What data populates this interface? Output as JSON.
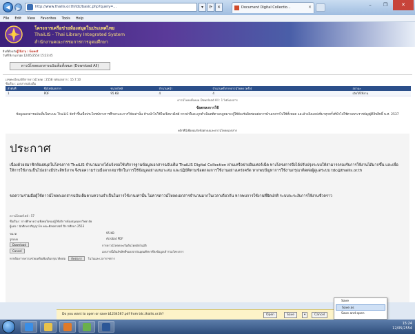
{
  "browser": {
    "address": "http://www.thailis.or.th/tdc/basic.php?query=...",
    "tab_title": "Document Digital Collectio...",
    "tab_close": "×",
    "menu": [
      "File",
      "Edit",
      "View",
      "Favorites",
      "Tools",
      "Help"
    ],
    "addr_tools": [
      "▾",
      "⟳",
      "✕"
    ],
    "window_controls": [
      "–",
      "❐",
      "✕"
    ]
  },
  "banner": {
    "line1": "โครงการเครือข่ายห้องสมุดในประเทศไทย",
    "line2": "ThaiLIS - Thai Library Integrated System",
    "line3": "สำนักงานคณะกรรมการการอุดมศึกษา"
  },
  "user": {
    "line1_prefix": "ยินดีต้อนรับ",
    "line1_name": "ผู้ใช้งาน : Guest",
    "line2": "วันที่ใช้งานล่าสุด 12/05/2554 15:23:45"
  },
  "top_button": "ดาวน์โหลดเอกสารฉบับเต็มทั้งหมด (Download All)",
  "meta": {
    "line1": "เลขทะเบียนสถิติการดาวน์โหลด : 2558 รหัสเอกสาร : 15.7.10",
    "line2": "ชื่อเรื่อง : เอกสารฉบับเต็ม"
  },
  "stats_table": {
    "headers": [
      "ลำดับที่",
      "ชื่อไฟล์เอกสาร",
      "ขนาดไฟล์",
      "จำนวนหน้า",
      "จำนวนครั้งการดาวน์โหลด (ครั้ง)",
      "สถานะ"
    ],
    "row": [
      "1",
      "PDF",
      "95 KB",
      "4",
      "4",
      "เปิดให้ใช้งาน"
    ]
  },
  "bar_note": "ดาวน์โหลดทั้งหมด Download All : 1 ไฟล์เอกสาร",
  "section_heading": "ข้อตกลงการใช้",
  "section_paragraph": "ข้อมูลเอกสารฉบับเต็มในระบบ ThaiLIS จัดทำขึ้นเพื่อประโยชน์ทางการศึกษาและการวิจัยเท่านั้น ห้ามนำไปใช้ในเชิงพาณิชย์ หากฝ่าฝืนจะถูกดำเนินคดีตามกฎหมาย ผู้ใช้ต้องรับผิดชอบต่อการนำเอกสารไปใช้ทั้งหมด และอ้างอิงแหล่งที่มาทุกครั้งที่นำไปใช้ตามพระราชบัญญัติลิขสิทธิ์ พ.ศ. 2537",
  "section_link": "คลิกที่นี่เพื่อยอมรับข้อตกลงและดาวน์โหลดเอกสาร",
  "announce": {
    "title": "ประกาศ",
    "p1": "เนื่องด้วยสมาชิกห้องสมุดในโครงการ ThaiLIS จำนวนมากได้แจ้งขอใช้บริการฐานข้อมูลเอกสารฉบับเต็ม ThaiLIS Digital Collection ผ่านเครือข่ายอินเทอร์เน็ต ทางโครงการจึงได้ปรับปรุงระบบให้สามารถรองรับการใช้งานได้มากขึ้น และเพื่อให้การใช้งานเป็นไปอย่างมีประสิทธิภาพ จึงขอความร่วมมือจากสมาชิกในการใช้ข้อมูลอย่างเหมาะสม และปฏิบัติตามข้อตกลงการใช้งานอย่างเคร่งครัด หากพบปัญหาการใช้งานกรุณาติดต่อผู้ดูแลระบบ tdc@thailis.or.th",
    "p2": "ขอความร่วมมือผู้ใช้ดาวน์โหลดเอกสารฉบับเต็มตามความจำเป็นในการใช้งานเท่านั้น ไม่ควรดาวน์โหลดเอกสารจำนวนมากในเวลาเดียวกัน หากพบการใช้งานที่ผิดปกติ ระบบจะระงับการใช้งานชั่วคราว",
    "small1": "ดาวน์โหลดไฟล์ : 57",
    "row1": "ชื่อเรื่อง : การศึกษาความพึงพอใจของผู้ใช้บริการห้องสมุดมหาวิทยาลัย",
    "row2": "ผู้แต่ง : นักศึกษาปริญญาโท คณะศิลปศาสตร์ ปีการศึกษา 2553",
    "field1_label": "ขนาด",
    "field1_value": "95 KB",
    "field2_label": "รูปแบบ",
    "field2_value": "Acrobat PDF",
    "btn_a": "Download",
    "btn_b": "Cancel",
    "row3": "การดาวน์โหลดจะเริ่มต้นโดยอัตโนมัติ",
    "row4": "เอกสารนี้เป็นลิขสิทธิ์ของสถาบันอุดมศึกษาที่ส่งข้อมูลเข้าร่วมโครงการ",
    "footer_text": "หากต้องการความช่วยเหลือเพิ่มเติมกรุณาติดต่อ",
    "footer_btn": "ติดต่อเรา",
    "footer_after": "ในวันและเวลาราชการ"
  },
  "context_menu": [
    "Save",
    "Save as",
    "Save and open"
  ],
  "download_bar": {
    "message": "Do you want to open or save b1234567.pdf from tdc.thailis.or.th?",
    "open": "Open",
    "save": "Save",
    "cancel": "Cancel",
    "close": "×"
  },
  "taskbar": {
    "time": "15:24",
    "date": "12/05/2554"
  }
}
